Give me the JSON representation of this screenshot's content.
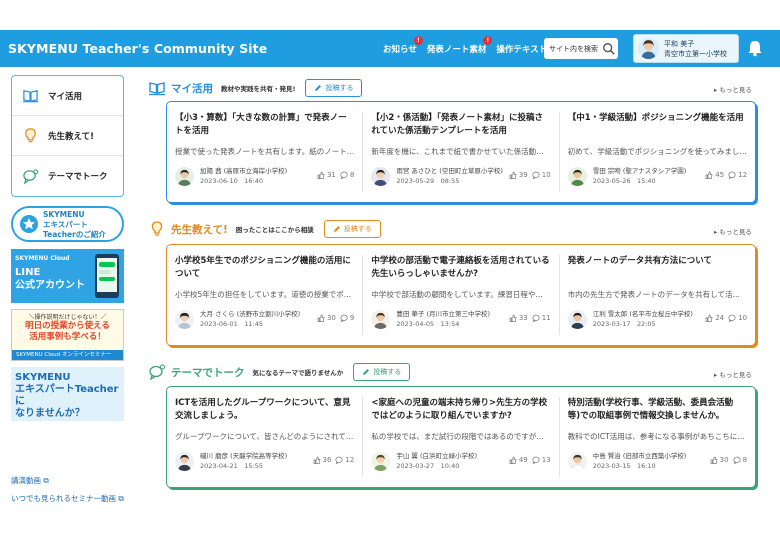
{
  "header": {
    "site_title": "SKYMENU Teacher's Community Site",
    "nav": [
      {
        "label": "お知らせ",
        "badge": "!"
      },
      {
        "label": "発表ノート素材",
        "badge": "!"
      },
      {
        "label": "操作テキスト",
        "badge": ""
      }
    ],
    "search_placeholder": "サイト内を検索",
    "user_name": "平和 美子",
    "user_school": "青空市立第一小学校"
  },
  "sidebar": {
    "menu": [
      {
        "label": "マイ活用",
        "icon": "book-icon"
      },
      {
        "label": "先生教えて!",
        "icon": "lightbulb-icon"
      },
      {
        "label": "テーマでトーク",
        "icon": "chat-icon"
      }
    ],
    "expert_banner": [
      "SKYMENU",
      "エキスパート",
      "Teacherのご紹介"
    ],
    "line_banner": {
      "top": "SKYMENU Cloud",
      "line1": "LINE",
      "line2": "公式アカウント"
    },
    "seminar_banner": {
      "top": "＼操作説明だけじゃない！／",
      "line1": "明日の授業から使える",
      "line2": "活用事例も学べる！",
      "foot": "SKYMENU Cloud オンラインセミナー"
    },
    "become_banner": [
      "SKYMENU",
      "エキスパートTeacherに",
      "なりませんか？"
    ],
    "links": [
      "講演動画",
      "いつでも見られるセミナー動画"
    ]
  },
  "sections": [
    {
      "title": "マイ活用",
      "desc": "教材や実践を共有・発見!",
      "post_label": "投稿する",
      "more": "もっと見る",
      "color": "#2b8fe0",
      "cards": [
        {
          "title": "【小3・算数】「大きな数の計算」で発表ノートを活用",
          "body": "授業で使った発表ノートを共有します。紙のノート…",
          "author": "加陽 茜 (高原市立海岸小学校)",
          "date": "2023-06-10　16:40",
          "likes": "31",
          "comments": "8"
        },
        {
          "title": "【小2・係活動】「発表ノート素材」に投稿されていた係活動テンプレートを活用",
          "body": "新年度を機に、これまで紙で書かせていた係活動…",
          "author": "雨宮 あさひと (空田町立草原小学校)",
          "date": "2023-05-29　08:55",
          "likes": "39",
          "comments": "10"
        },
        {
          "title": "【中1・学級活動】ポジショニング機能を活用",
          "body": "初めて、学級活動でポジショニングを使ってみまし…",
          "author": "雪田 宗吻 (聖アナスタシア学園)",
          "date": "2023-05-26　15:40",
          "likes": "45",
          "comments": "12"
        }
      ]
    },
    {
      "title": "先生教えて!",
      "desc": "困ったことはここから相談",
      "post_label": "投稿する",
      "more": "もっと見る",
      "color": "#e08a24",
      "cards": [
        {
          "title": "小学校5年生でのポジショニング機能の活用について",
          "body": "小学校5年生の担任をしています。道徳の授業でポ…",
          "author": "大月 さくら (渋野市立劉川小学校)",
          "date": "2023-06-01　11:45",
          "likes": "30",
          "comments": "9"
        },
        {
          "title": "中学校の部活動で電子連絡板を活用されている先生いらっしゃいませんか?",
          "body": "中学校で部活動の顧問をしています。練習日程や…",
          "author": "豊田 華子 (月川市立第三中学校)",
          "date": "2023-04-05　13:54",
          "likes": "33",
          "comments": "11"
        },
        {
          "title": "発表ノートのデータ共有方法について",
          "body": "市内の先生方で発表ノートのデータを共有して活…",
          "author": "江利 雪太郎 (名平市立桜丘中学校)",
          "date": "2023-03-17　22:05",
          "likes": "24",
          "comments": "10"
        }
      ]
    },
    {
      "title": "テーマでトーク",
      "desc": "気になるテーマで語りませんか",
      "post_label": "投稿する",
      "more": "もっと見る",
      "color": "#3aa37a",
      "cards": [
        {
          "title": "ICTを活用したグループワークについて、意見交流しましょう。",
          "body": "グループワークについて、皆さんどのようにされて…",
          "author": "磯川 磨彦 (天龍学院高等学校)",
          "date": "2023-04-21　15:55",
          "likes": "36",
          "comments": "12"
        },
        {
          "title": "<家庭への児童の端末持ち帰り>先生方の学校ではどのように取り組んでいますか?",
          "body": "私の学校では、まだ試行の段階ではあるのですが…",
          "author": "宇山 翼 (白浜町立緑小学校)",
          "date": "2023-03-27　10:40",
          "likes": "49",
          "comments": "13"
        },
        {
          "title": "特別活動(学校行事、学級活動、委員会活動 等)での取組事例で情報交換しませんか。",
          "body": "教科でのICT活用は、参考になる事例があちこちに…",
          "author": "中島 賢治 (旧部市立西築小学校)",
          "date": "2023-03-15　16:10",
          "likes": "30",
          "comments": "8"
        }
      ]
    }
  ]
}
